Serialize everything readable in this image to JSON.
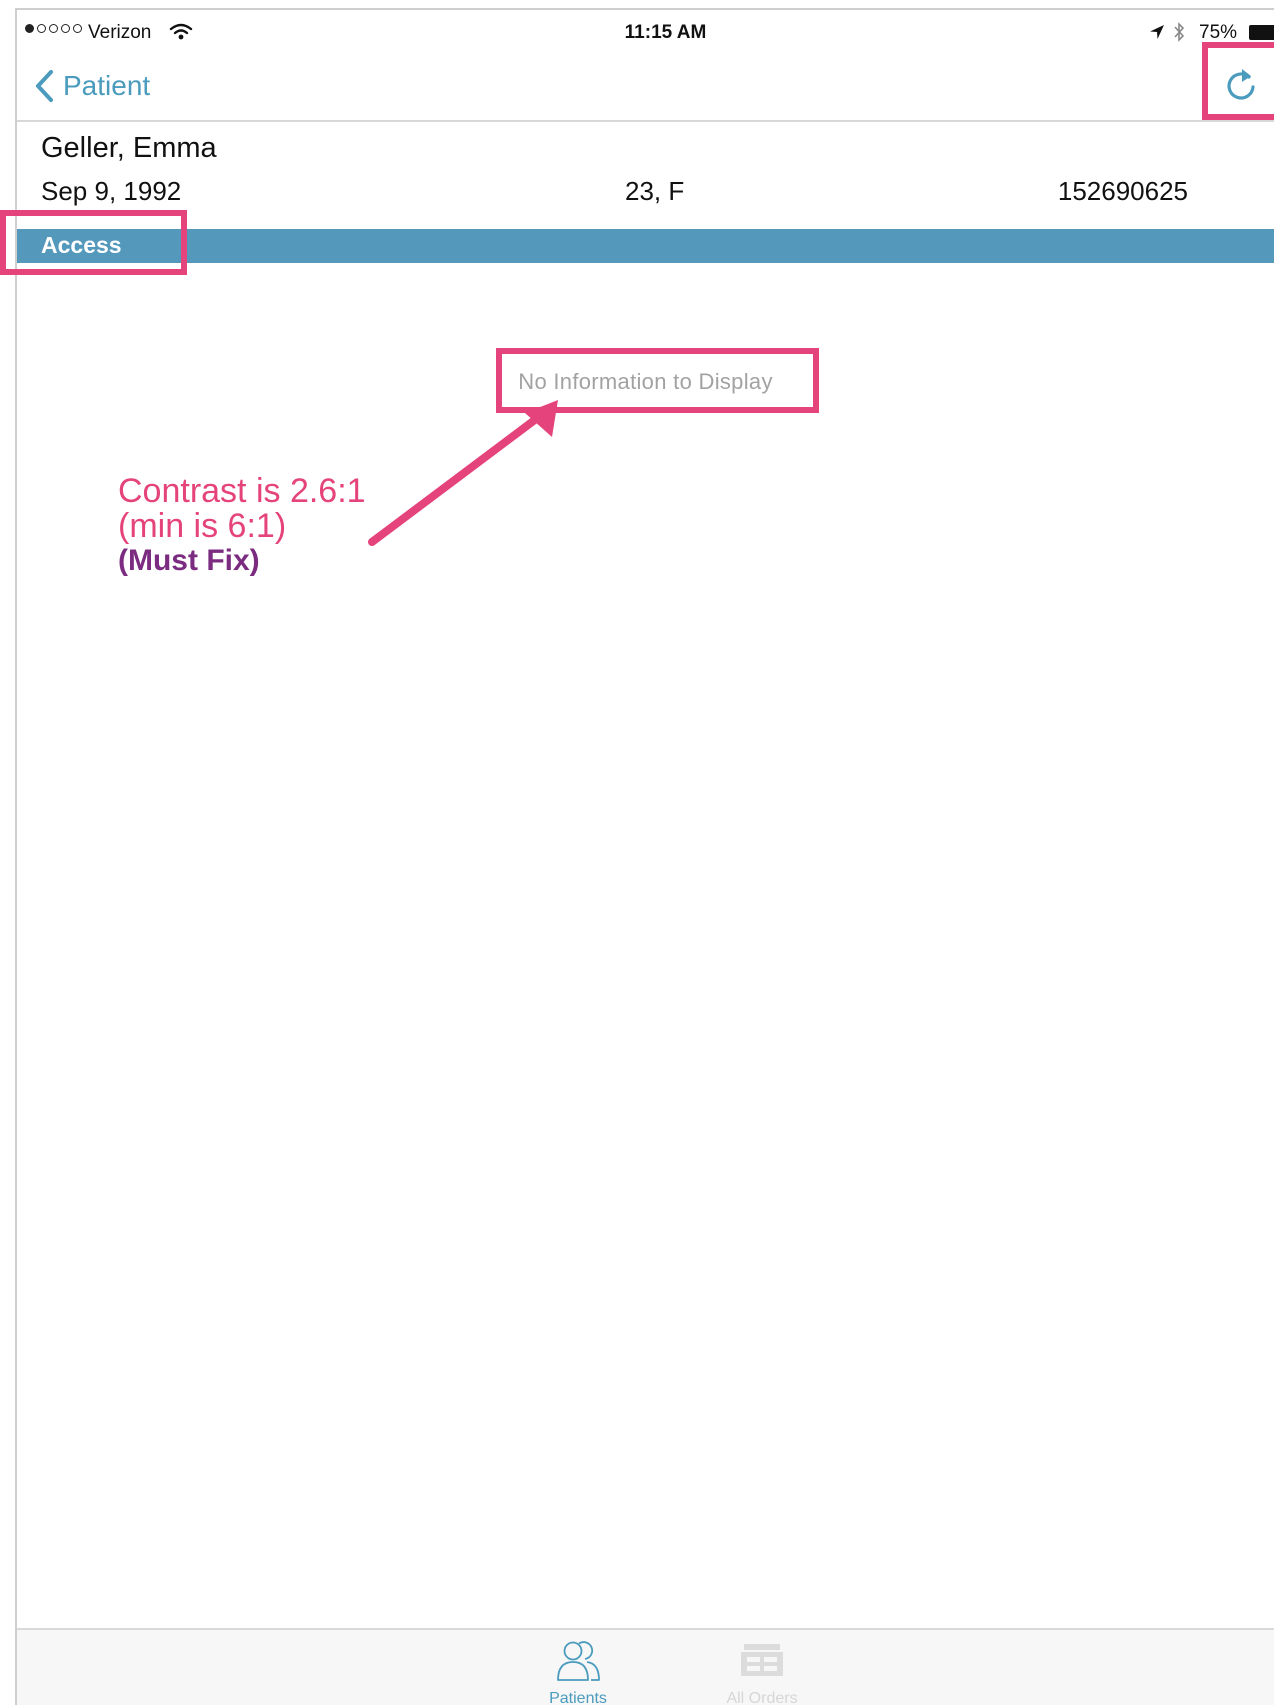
{
  "status_bar": {
    "carrier": "Verizon",
    "signal_bars_filled": 1,
    "signal_bars_total": 5,
    "time": "11:15 AM",
    "battery_percent": "75%"
  },
  "nav": {
    "back_label": "Patient",
    "back_icon": "chevron-left-icon",
    "refresh_icon": "refresh-icon"
  },
  "patient": {
    "name": "Geller, Emma",
    "dob": "Sep 9, 1992",
    "age_sex": "23, F",
    "mrn": "152690625"
  },
  "section": {
    "title": "Access"
  },
  "content": {
    "empty_message": "No Information to Display"
  },
  "tab_bar": {
    "tabs": [
      {
        "label": "Patients",
        "icon": "patients-icon",
        "selected": true
      },
      {
        "label": "All Orders",
        "icon": "orders-icon",
        "selected": false
      }
    ]
  },
  "annotation": {
    "line1": "Contrast is 2.6:1",
    "line2": "(min is 6:1)",
    "line3": "(Must Fix)"
  },
  "colors": {
    "accent": "#4a9bbd",
    "section_bar": "#5499bc",
    "empty_text": "#a2a2a2",
    "annotation_pink": "#e5437b",
    "annotation_purple": "#7b2c80"
  }
}
